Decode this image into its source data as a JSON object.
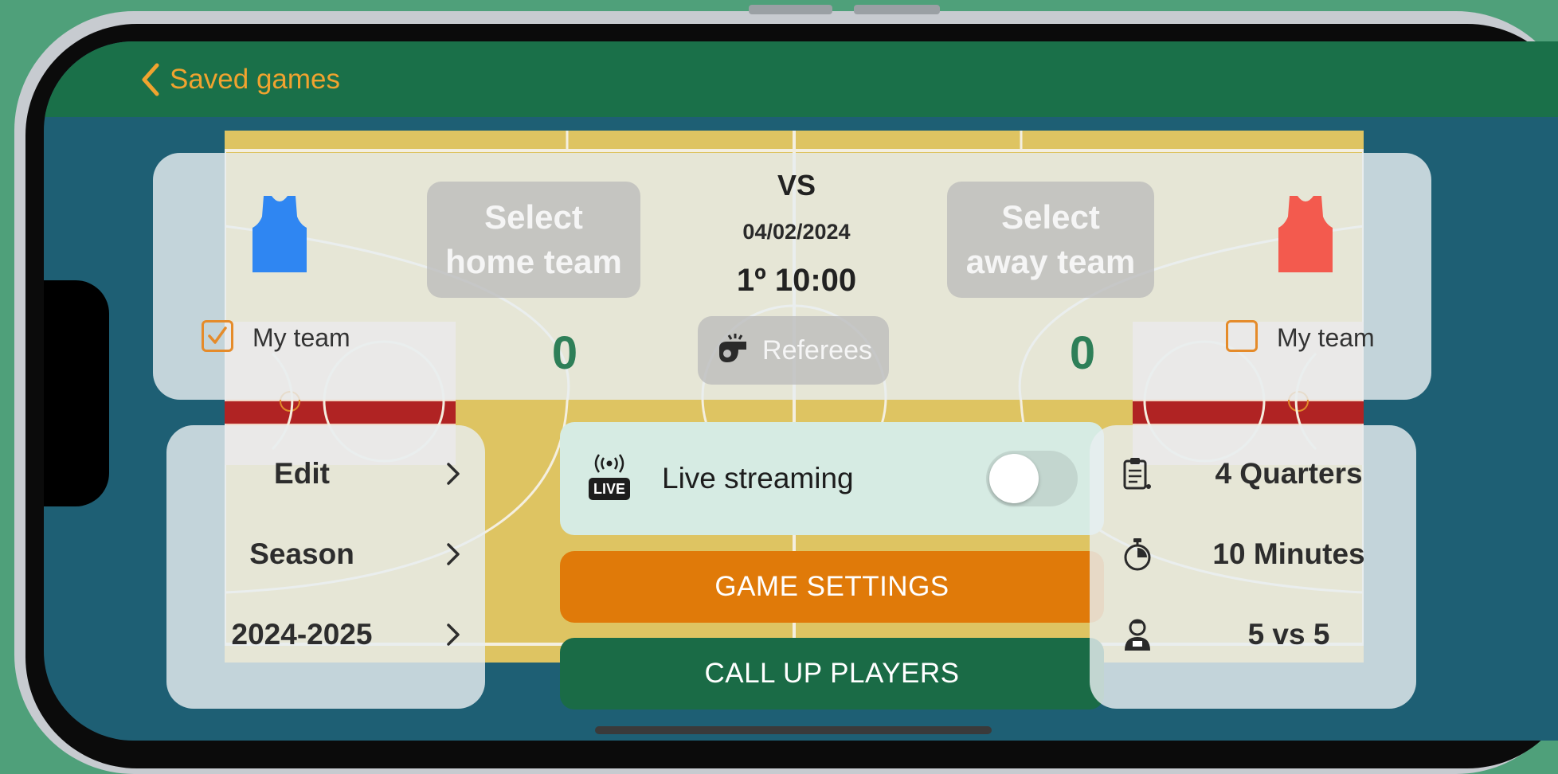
{
  "nav": {
    "back_label": "Saved games"
  },
  "matchup": {
    "vs_label": "VS",
    "date": "04/02/2024",
    "period": "1º",
    "clock": "10:00",
    "home": {
      "select_line1": "Select",
      "select_line2": "home team",
      "score": "0",
      "my_team_label": "My team",
      "my_team_checked": true,
      "jersey_color": "#2f86f2"
    },
    "away": {
      "select_line1": "Select",
      "select_line2": "away team",
      "score": "0",
      "my_team_label": "My team",
      "my_team_checked": false,
      "jersey_color": "#f35a4e"
    },
    "referees_label": "Referees"
  },
  "left_menu": [
    {
      "label": "Edit"
    },
    {
      "label": "Season"
    },
    {
      "label": "2024-2025"
    }
  ],
  "live_streaming": {
    "label": "Live streaming",
    "badge": "LIVE",
    "enabled": false
  },
  "actions": {
    "game_settings": "GAME SETTINGS",
    "call_up_players": "CALL UP PLAYERS"
  },
  "game_info": [
    {
      "icon": "clipboard-icon",
      "label": "4 Quarters"
    },
    {
      "icon": "stopwatch-icon",
      "label": "10 Minutes"
    },
    {
      "icon": "player-icon",
      "label": "5 vs 5"
    }
  ],
  "colors": {
    "nav": "#1a7049",
    "accent": "#f0a32f",
    "orange_button": "#e07a09",
    "green_button": "#1a6b46",
    "score": "#2e7f58",
    "background": "#1e5f74"
  }
}
